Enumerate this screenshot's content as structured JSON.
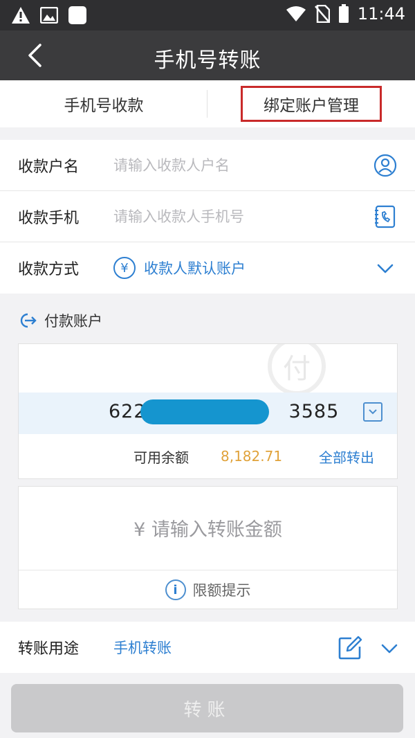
{
  "status_bar": {
    "time": "11:44",
    "icons": [
      "warning-icon",
      "image-icon",
      "app-square-icon",
      "wifi-icon",
      "no-sim-icon",
      "battery-icon"
    ]
  },
  "nav": {
    "title": "手机号转账",
    "back_icon": "chevron-left-icon"
  },
  "tabs": [
    {
      "label": "手机号收款"
    },
    {
      "label": "绑定账户管理"
    }
  ],
  "form": {
    "payee_name": {
      "label": "收款户名",
      "placeholder": "请输入收款人户名",
      "icon": "person-circle-icon"
    },
    "payee_phone": {
      "label": "收款手机",
      "placeholder": "请输入收款人手机号",
      "icon": "contacts-book-icon"
    },
    "method": {
      "label": "收款方式",
      "value": "收款人默认账户",
      "icon": "yen-circle-icon",
      "yen": "¥"
    }
  },
  "pay_account": {
    "header": "付款账户",
    "watermark": "付",
    "account_prefix": "622",
    "account_suffix": "3585",
    "balance_label": "可用余额",
    "balance_value": "8,182.71",
    "transfer_all": "全部转出"
  },
  "amount": {
    "placeholder": "¥  请输入转账金额",
    "limit_tip": "限额提示",
    "info_glyph": "i"
  },
  "purpose": {
    "label": "转账用途",
    "value": "手机转账"
  },
  "submit": {
    "label": "转账"
  },
  "colors": {
    "accent": "#2d7fd1",
    "balance": "#e0a23a",
    "highlight": "#c92a2a",
    "nav_bg": "#3b3b3d"
  }
}
